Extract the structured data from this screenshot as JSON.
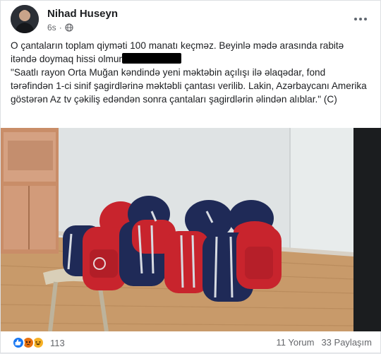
{
  "post": {
    "author": "Nihad Huseyn",
    "time": "6s",
    "privacy_icon": "globe-icon",
    "more_icon": "more-options-icon",
    "text_line1": "O çantaların toplam qiyməti 100 manatı keçməz. Beyinlə mədə arasında rabitə itəndə doymaq hissi olmur",
    "quote": "\"Saatlı rayon Orta Muğan kəndində yeni məktəbin açılışı ilə əlaqədar, fond tərəfindən 1-ci sinif şagirdlərinə məktəbli çantası verilib. Lakin, Azərbaycanı Amerika göstərən Az tv çəkiliş edəndən sonra çantaları şagirdlərin əlindən alıblar.\" (C)",
    "photo_icon": "school-backpacks-photo"
  },
  "footer": {
    "reaction_icons": [
      "like-icon",
      "angry-icon",
      "haha-icon"
    ],
    "reaction_count": "113",
    "comments": "11 Yorum",
    "shares": "33 Paylaşım"
  },
  "colors": {
    "like": "#1877f2",
    "angry": "#e9710f",
    "haha": "#f7b125",
    "backpack_red": "#c8242d",
    "backpack_navy": "#1f2a57"
  }
}
